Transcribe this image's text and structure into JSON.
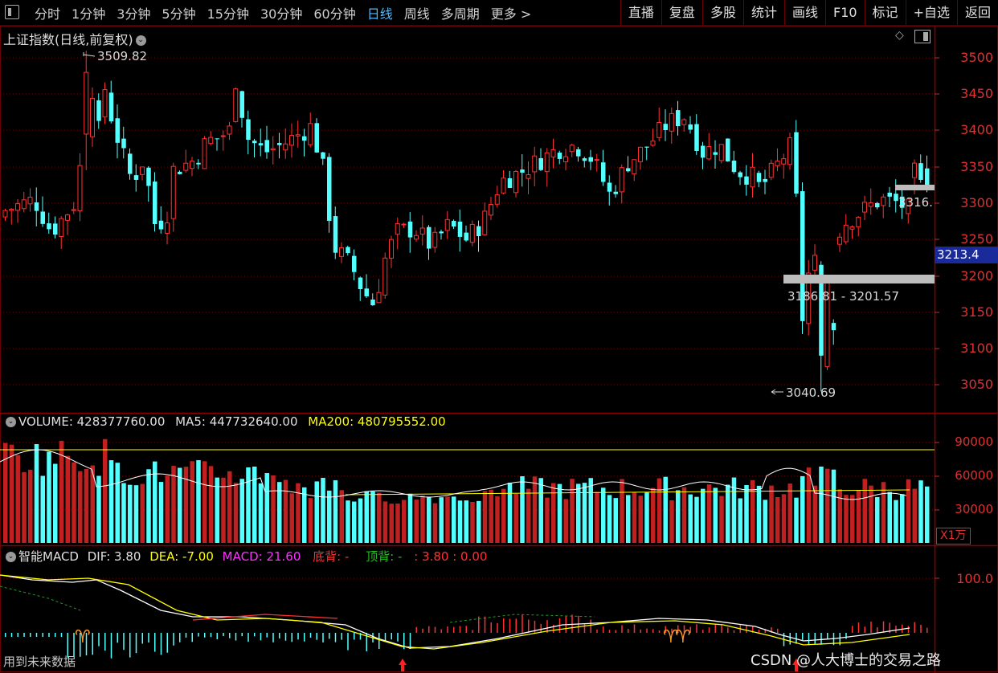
{
  "toolbar": {
    "tabs": [
      "分时",
      "1分钟",
      "3分钟",
      "5分钟",
      "15分钟",
      "30分钟",
      "60分钟",
      "日线",
      "周线",
      "多周期",
      "更多 >"
    ],
    "active_tab": "日线",
    "right_buttons": [
      "直播",
      "复盘",
      "多股",
      "统计",
      "画线",
      "F10",
      "标记",
      "+自选",
      "返回"
    ]
  },
  "main": {
    "title": "上证指数(日线,前复权)",
    "high_label": "3509.82",
    "low_label": "3040.69",
    "gap1_label": "3186.81 - 3201.57",
    "gap2_label": "3316.",
    "current_price": "3213.4",
    "y_ticks": [
      "3500",
      "3450",
      "3400",
      "3350",
      "3300",
      "3250",
      "3200",
      "3150",
      "3100",
      "3050"
    ]
  },
  "volume": {
    "label_volume": "VOLUME: 428377760.00",
    "label_ma5": "MA5: 447732640.00",
    "label_ma200": "MA200: 480795552.00",
    "y_ticks": [
      "90000",
      "60000",
      "30000"
    ],
    "unit": "X1万"
  },
  "macd": {
    "name": "智能MACD",
    "dif": "DIF: 3.80",
    "dea": "DEA: -7.00",
    "macd": "MACD: 21.60",
    "bottom_div": "底背: -",
    "top_div": "顶背: -",
    "extra": ": 3.80 : 0.00",
    "y_tick": "100.0",
    "footer": "用到未来数据"
  },
  "watermark": "CSDN @人大博士的交易之路",
  "colors": {
    "up": "#ff3030",
    "down": "#54ffff",
    "grid": "#7a0000",
    "yellow": "#ffff00"
  }
}
